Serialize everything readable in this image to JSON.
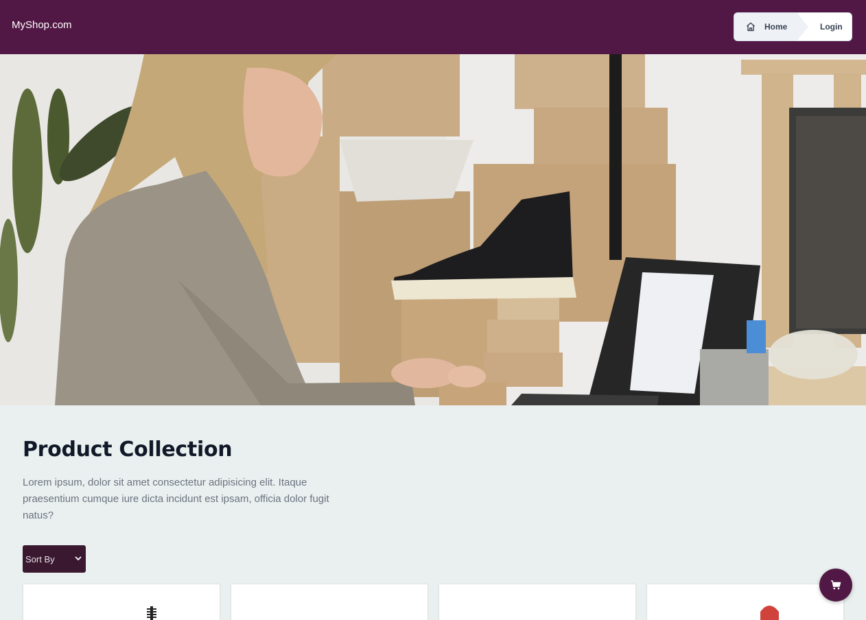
{
  "header": {
    "brand": "MyShop.com",
    "breadcrumb": {
      "home_label": "Home",
      "login_label": "Login"
    }
  },
  "hero": {
    "image": "woman packing boxes with sneaker and laptop"
  },
  "collection": {
    "title": "Product Collection",
    "description": "Lorem ipsum, dolor sit amet consectetur adipisicing elit. Itaque praesentium cumque iure dicta incidunt est ipsam, officia dolor fugit natus?",
    "sort_label": "Sort By"
  },
  "products": [
    {
      "image": "mascara"
    },
    {
      "image": "product"
    },
    {
      "image": "product"
    },
    {
      "image": "lipstick"
    }
  ],
  "icons": {
    "home": "home-icon",
    "chevron": "chevron-down-icon",
    "cart": "shopping-cart-icon"
  },
  "colors": {
    "header_bg": "#521845",
    "page_bg": "#eaf0ef",
    "sort_bg": "#3a1830",
    "accent": "#521845"
  }
}
